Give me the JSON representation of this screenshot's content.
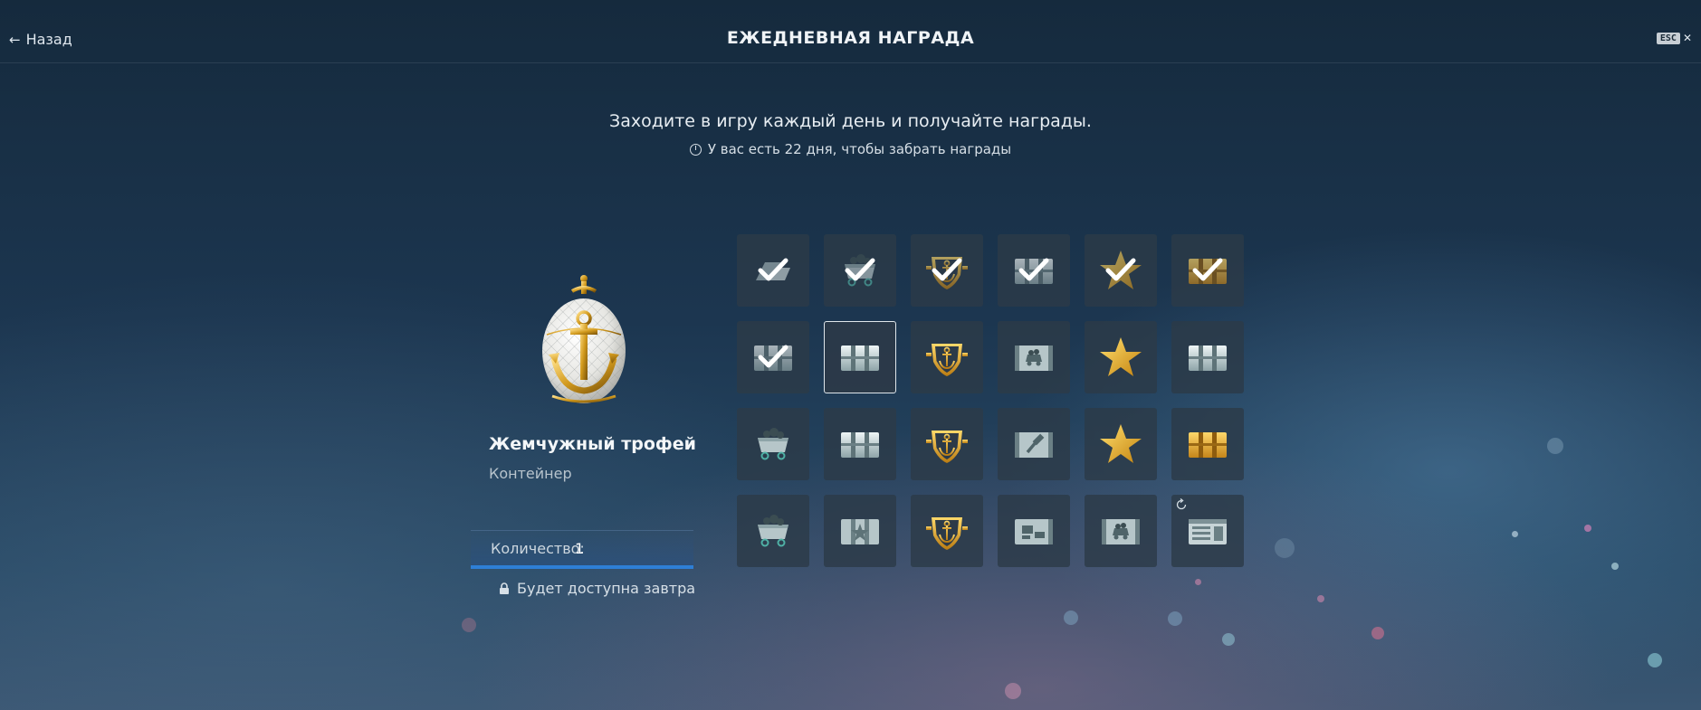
{
  "header": {
    "back_label": "Назад",
    "title": "ЕЖЕДНЕВНАЯ НАГРАДА",
    "esc_label": "ESC"
  },
  "info": {
    "subtitle": "Заходите в игру каждый день и получайте награды.",
    "timer_text": "У вас есть 22 дня, чтобы забрать награды"
  },
  "prize": {
    "name": "Жемчужный трофей",
    "type": "Контейнер",
    "quantity_label": "Количество:",
    "quantity_value": "1",
    "availability": "Будет доступна завтра"
  },
  "rewards": [
    {
      "icon": "steel-icon",
      "state": "claimed"
    },
    {
      "icon": "coal-cart-icon",
      "state": "claimed"
    },
    {
      "icon": "anchor-shield-icon",
      "state": "claimed"
    },
    {
      "icon": "container-icon",
      "state": "claimed"
    },
    {
      "icon": "star-icon",
      "state": "claimed"
    },
    {
      "icon": "gold-container-icon",
      "state": "claimed"
    },
    {
      "icon": "container-icon",
      "state": "claimed"
    },
    {
      "icon": "container-icon",
      "state": "selected"
    },
    {
      "icon": "anchor-shield-icon",
      "state": "available"
    },
    {
      "icon": "coal-container-icon",
      "state": "available"
    },
    {
      "icon": "star-icon",
      "state": "available"
    },
    {
      "icon": "container-icon",
      "state": "available"
    },
    {
      "icon": "coal-cart-icon",
      "state": "available"
    },
    {
      "icon": "container-icon",
      "state": "available"
    },
    {
      "icon": "anchor-shield-icon",
      "state": "available"
    },
    {
      "icon": "tool-container-icon",
      "state": "available"
    },
    {
      "icon": "star-icon",
      "state": "available"
    },
    {
      "icon": "gold-container-icon",
      "state": "available"
    },
    {
      "icon": "coal-cart-icon",
      "state": "available"
    },
    {
      "icon": "star-container-icon",
      "state": "available"
    },
    {
      "icon": "anchor-shield-icon",
      "state": "available"
    },
    {
      "icon": "camo-container-icon",
      "state": "available"
    },
    {
      "icon": "coal-container-icon",
      "state": "available"
    },
    {
      "icon": "supply-container-icon",
      "state": "repeat"
    }
  ],
  "colors": {
    "accent_blue": "#2e7fd6",
    "gold": "#e0a935",
    "silver": "#b8c8cc"
  }
}
